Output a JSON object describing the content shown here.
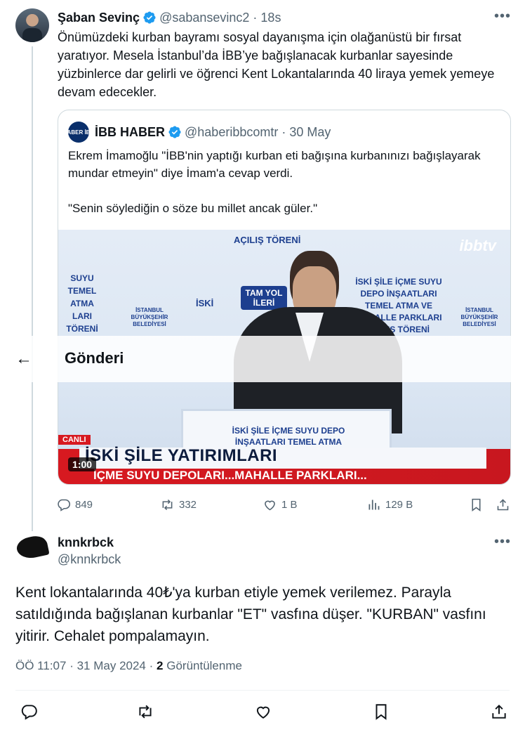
{
  "tweet": {
    "author_name": "Şaban Sevinç",
    "handle": "@sabansevinc2",
    "separator": "·",
    "time": "18s",
    "text": "Önümüzdeki kurban bayramı sosyal dayanışma için olağanüstü bir fırsat yaratıyor. Mesela İstanbul’da İBB’ye bağışlanacak kurbanlar sayesinde yüzbinlerce dar gelirli ve öğrenci Kent Lokantalarında 40 liraya yemek yemeye devam edecekler.",
    "more_label": "•••",
    "stats": {
      "replies": "849",
      "reposts": "332",
      "likes": "1 B",
      "views": "129 B"
    }
  },
  "quote": {
    "logo_text": "HABER İBB",
    "author_name": "İBB HABER",
    "handle": "@haberibbcomtr",
    "separator": "·",
    "date": "30 May",
    "text_line1": "Ekrem İmamoğlu \"İBB'nin yaptığı kurban eti bağışına kurbanınızı bağışlayarak mundar etmeyin\" diye İmam'a cevap verdi.",
    "text_line2": "\"Senin söylediğin o söze bu millet ancak güler.\"",
    "video": {
      "duration": "1:00",
      "live_label": "CANLI",
      "channel_logo": "ibbtv",
      "ticker_title": "İSKİ ŞİLE YATIRIMLARI",
      "ticker_sub": "İÇME SUYU DEPOLARI...MAHALLE PARKLARI...",
      "banner_top": "AÇILIŞ TÖRENİ",
      "banner_left": "SUYU TEMEL ATMA LARI TÖRENİ",
      "banner_right": "İSKİ ŞİLE İÇME SUYU DEPO İNŞAATLARI TEMEL ATMA VE MAHALLE PARKLARI AÇILIŞ TÖRENİ",
      "banner_sign": "TAM YOL İLERİ",
      "podium_text": "İSKİ ŞİLE İÇME SUYU DEPO İNŞAATLARI TEMEL ATMA",
      "org_left": "İSTANBUL BÜYÜKŞEHİR BELEDİYESİ",
      "org_right": "İSTANBUL BÜYÜKŞEHİR BELEDİYESİ",
      "org_mid": "İSKİ"
    }
  },
  "overlay": {
    "back_label": "←",
    "title": "Gönderi"
  },
  "reply": {
    "author_name": "knnkrbck",
    "handle": "@knnkrbck",
    "more_label": "•••",
    "text": "Kent lokantalarında 40₺'ya kurban etiyle yemek verilemez. Parayla satıldığında bağışlanan kurbanlar \"ET\" vasfına düşer. \"KURBAN\" vasfını yitirir. Cehalet pompalamayın.",
    "time": "ÖÖ 11:07",
    "date": "31 May 2024",
    "separator": "·",
    "views_count": "2",
    "views_label": "Görüntülenme"
  },
  "colors": {
    "verified": "#1d9bf0",
    "muted": "#536471",
    "ticker_red": "#d71920",
    "border": "#cfd9de"
  }
}
